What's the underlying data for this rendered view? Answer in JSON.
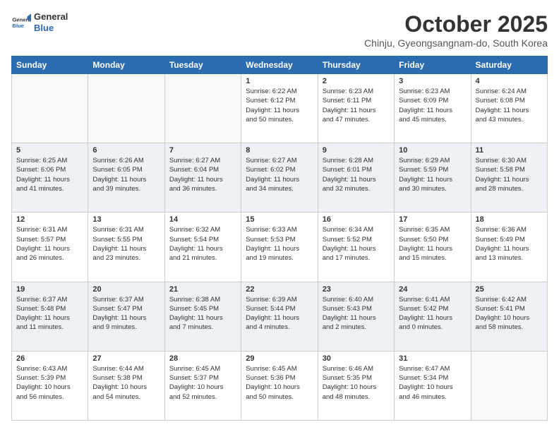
{
  "header": {
    "logo_general": "General",
    "logo_blue": "Blue",
    "month": "October 2025",
    "location": "Chinju, Gyeongsangnam-do, South Korea"
  },
  "weekdays": [
    "Sunday",
    "Monday",
    "Tuesday",
    "Wednesday",
    "Thursday",
    "Friday",
    "Saturday"
  ],
  "weeks": [
    [
      {
        "day": "",
        "info": ""
      },
      {
        "day": "",
        "info": ""
      },
      {
        "day": "",
        "info": ""
      },
      {
        "day": "1",
        "info": "Sunrise: 6:22 AM\nSunset: 6:12 PM\nDaylight: 11 hours\nand 50 minutes."
      },
      {
        "day": "2",
        "info": "Sunrise: 6:23 AM\nSunset: 6:11 PM\nDaylight: 11 hours\nand 47 minutes."
      },
      {
        "day": "3",
        "info": "Sunrise: 6:23 AM\nSunset: 6:09 PM\nDaylight: 11 hours\nand 45 minutes."
      },
      {
        "day": "4",
        "info": "Sunrise: 6:24 AM\nSunset: 6:08 PM\nDaylight: 11 hours\nand 43 minutes."
      }
    ],
    [
      {
        "day": "5",
        "info": "Sunrise: 6:25 AM\nSunset: 6:06 PM\nDaylight: 11 hours\nand 41 minutes."
      },
      {
        "day": "6",
        "info": "Sunrise: 6:26 AM\nSunset: 6:05 PM\nDaylight: 11 hours\nand 39 minutes."
      },
      {
        "day": "7",
        "info": "Sunrise: 6:27 AM\nSunset: 6:04 PM\nDaylight: 11 hours\nand 36 minutes."
      },
      {
        "day": "8",
        "info": "Sunrise: 6:27 AM\nSunset: 6:02 PM\nDaylight: 11 hours\nand 34 minutes."
      },
      {
        "day": "9",
        "info": "Sunrise: 6:28 AM\nSunset: 6:01 PM\nDaylight: 11 hours\nand 32 minutes."
      },
      {
        "day": "10",
        "info": "Sunrise: 6:29 AM\nSunset: 5:59 PM\nDaylight: 11 hours\nand 30 minutes."
      },
      {
        "day": "11",
        "info": "Sunrise: 6:30 AM\nSunset: 5:58 PM\nDaylight: 11 hours\nand 28 minutes."
      }
    ],
    [
      {
        "day": "12",
        "info": "Sunrise: 6:31 AM\nSunset: 5:57 PM\nDaylight: 11 hours\nand 26 minutes."
      },
      {
        "day": "13",
        "info": "Sunrise: 6:31 AM\nSunset: 5:55 PM\nDaylight: 11 hours\nand 23 minutes."
      },
      {
        "day": "14",
        "info": "Sunrise: 6:32 AM\nSunset: 5:54 PM\nDaylight: 11 hours\nand 21 minutes."
      },
      {
        "day": "15",
        "info": "Sunrise: 6:33 AM\nSunset: 5:53 PM\nDaylight: 11 hours\nand 19 minutes."
      },
      {
        "day": "16",
        "info": "Sunrise: 6:34 AM\nSunset: 5:52 PM\nDaylight: 11 hours\nand 17 minutes."
      },
      {
        "day": "17",
        "info": "Sunrise: 6:35 AM\nSunset: 5:50 PM\nDaylight: 11 hours\nand 15 minutes."
      },
      {
        "day": "18",
        "info": "Sunrise: 6:36 AM\nSunset: 5:49 PM\nDaylight: 11 hours\nand 13 minutes."
      }
    ],
    [
      {
        "day": "19",
        "info": "Sunrise: 6:37 AM\nSunset: 5:48 PM\nDaylight: 11 hours\nand 11 minutes."
      },
      {
        "day": "20",
        "info": "Sunrise: 6:37 AM\nSunset: 5:47 PM\nDaylight: 11 hours\nand 9 minutes."
      },
      {
        "day": "21",
        "info": "Sunrise: 6:38 AM\nSunset: 5:45 PM\nDaylight: 11 hours\nand 7 minutes."
      },
      {
        "day": "22",
        "info": "Sunrise: 6:39 AM\nSunset: 5:44 PM\nDaylight: 11 hours\nand 4 minutes."
      },
      {
        "day": "23",
        "info": "Sunrise: 6:40 AM\nSunset: 5:43 PM\nDaylight: 11 hours\nand 2 minutes."
      },
      {
        "day": "24",
        "info": "Sunrise: 6:41 AM\nSunset: 5:42 PM\nDaylight: 11 hours\nand 0 minutes."
      },
      {
        "day": "25",
        "info": "Sunrise: 6:42 AM\nSunset: 5:41 PM\nDaylight: 10 hours\nand 58 minutes."
      }
    ],
    [
      {
        "day": "26",
        "info": "Sunrise: 6:43 AM\nSunset: 5:39 PM\nDaylight: 10 hours\nand 56 minutes."
      },
      {
        "day": "27",
        "info": "Sunrise: 6:44 AM\nSunset: 5:38 PM\nDaylight: 10 hours\nand 54 minutes."
      },
      {
        "day": "28",
        "info": "Sunrise: 6:45 AM\nSunset: 5:37 PM\nDaylight: 10 hours\nand 52 minutes."
      },
      {
        "day": "29",
        "info": "Sunrise: 6:45 AM\nSunset: 5:36 PM\nDaylight: 10 hours\nand 50 minutes."
      },
      {
        "day": "30",
        "info": "Sunrise: 6:46 AM\nSunset: 5:35 PM\nDaylight: 10 hours\nand 48 minutes."
      },
      {
        "day": "31",
        "info": "Sunrise: 6:47 AM\nSunset: 5:34 PM\nDaylight: 10 hours\nand 46 minutes."
      },
      {
        "day": "",
        "info": ""
      }
    ]
  ]
}
